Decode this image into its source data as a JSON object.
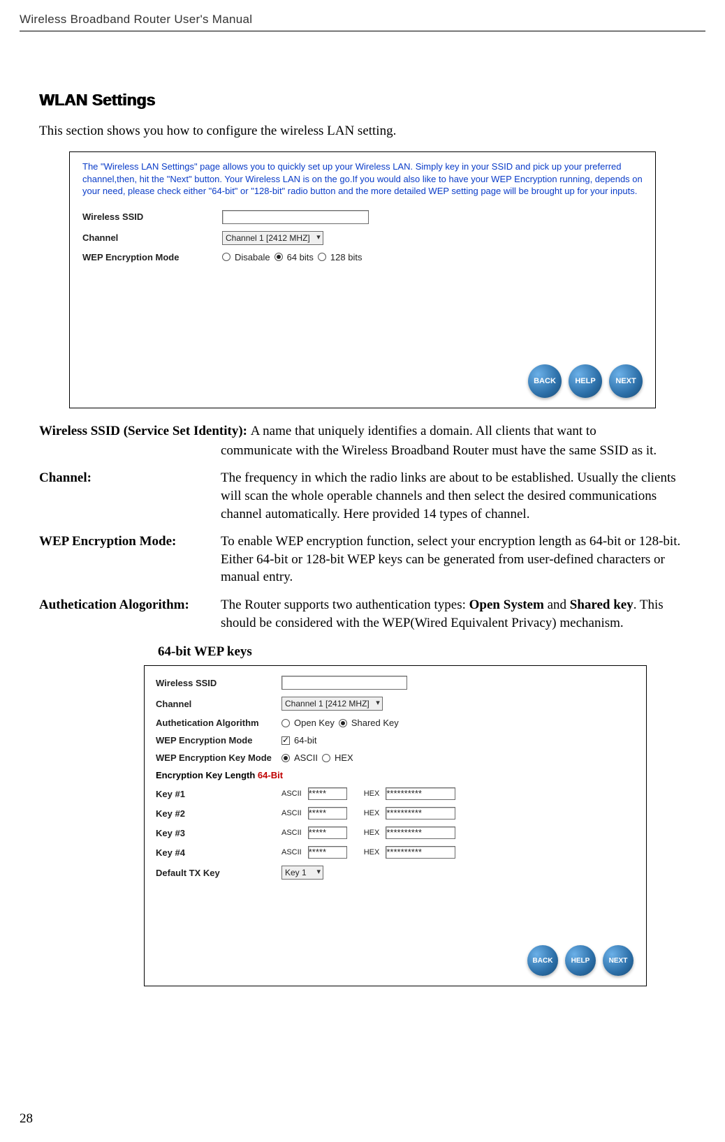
{
  "header": {
    "title": "Wireless Broadband Router User's Manual"
  },
  "page_number": "28",
  "section": {
    "title": "WLAN Settings",
    "intro": "This section shows you how to configure the wireless LAN setting."
  },
  "panel1": {
    "hint": "The \"Wireless LAN Settings\" page allows you to quickly set up your Wireless LAN. Simply key in your SSID and pick up your preferred channel,then, hit the \"Next\" button. Your Wireless LAN is on the go.If you would also like to have your WEP Encryption running, depends on your need, please check either \"64-bit\" or \"128-bit\" radio button and the more detailed WEP setting page will be brought up for your inputs.",
    "rows": {
      "ssid_label": "Wireless SSID",
      "channel_label": "Channel",
      "channel_value": "Channel 1 [2412 MHZ]",
      "wep_label": "WEP Encryption Mode",
      "wep_disable": "Disabale",
      "wep_64": "64 bits",
      "wep_128": "128 bits"
    },
    "nav": {
      "back": "BACK",
      "help": "HELP",
      "next": "NEXT"
    }
  },
  "defs": {
    "ssid_label": "Wireless SSID (Service Set Identity): ",
    "ssid_body_first": "A name that uniquely identifies a domain. All clients that want to",
    "ssid_body_rest": "communicate with the Wireless Broadband Router must have the same SSID as it.",
    "channel_label": "Channel:",
    "channel_body": "The frequency in which the radio links are about to be established. Usually the clients will scan the whole operable channels and then select the desired communications channel automatically. Here provided 14 types of channel.",
    "wep_label": "WEP Encryption Mode:",
    "wep_body": "To enable WEP encryption function, select your encryption length as 64-bit or 128-bit. Either 64-bit or 128-bit WEP keys can be generated from user-defined characters or manual entry.",
    "auth_label": "Authetication Alogorithm:",
    "auth_body_pre": "The Router supports two authentication types: ",
    "auth_body_b1": "Open System",
    "auth_body_mid": " and ",
    "auth_body_b2": "Shared key",
    "auth_body_post": ". This should be considered with the WEP(Wired Equivalent Privacy) mechanism."
  },
  "subhead": "64-bit WEP keys",
  "panel2": {
    "ssid_label": "Wireless SSID",
    "channel_label": "Channel",
    "channel_value": "Channel 1 [2412 MHZ]",
    "auth_label": "Authetication Algorithm",
    "auth_open": "Open Key",
    "auth_shared": "Shared Key",
    "wep_mode_label": "WEP Encryption Mode",
    "wep_mode_value": "64-bit",
    "key_mode_label": "WEP Encryption Key Mode",
    "key_mode_ascii": "ASCII",
    "key_mode_hex": "HEX",
    "enc_len_label": "Encryption Key Length",
    "enc_len_value": "64-Bit",
    "key1": "Key #1",
    "key2": "Key #2",
    "key3": "Key #3",
    "key4": "Key #4",
    "ascii_stars": "*****",
    "hex_stars": "**********",
    "ascii_sub": "ASCII",
    "hex_sub": "HEX",
    "defkey_label": "Default TX Key",
    "defkey_value": "Key 1",
    "nav": {
      "back": "BACK",
      "help": "HELP",
      "next": "NEXT"
    }
  }
}
